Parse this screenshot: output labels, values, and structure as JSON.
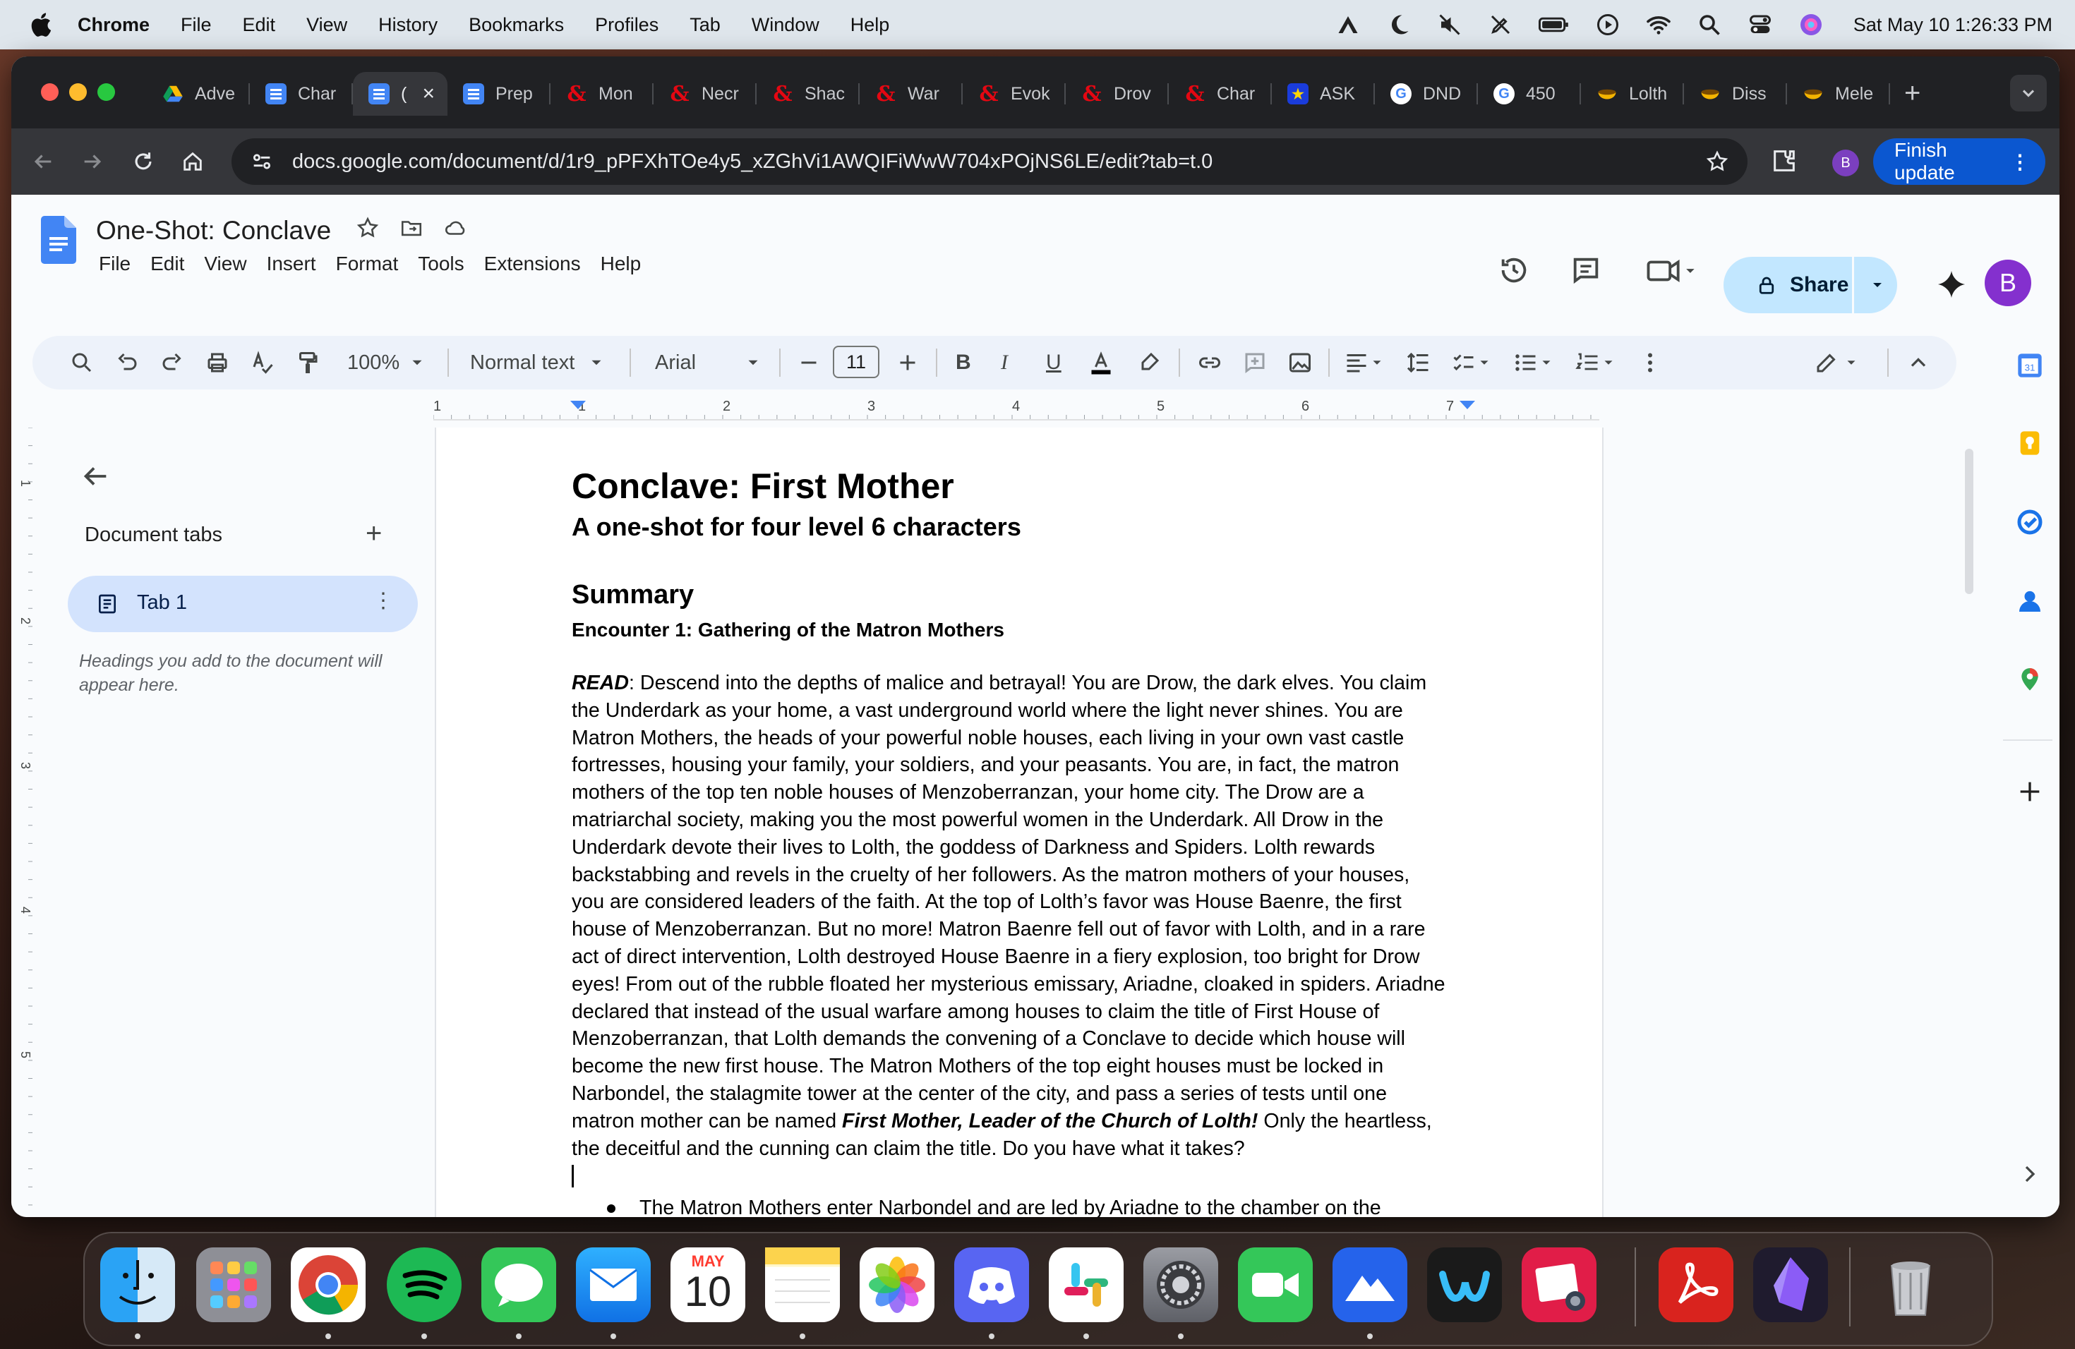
{
  "menubar": {
    "app": "Chrome",
    "items": [
      "File",
      "Edit",
      "View",
      "History",
      "Bookmarks",
      "Profiles",
      "Tab",
      "Window",
      "Help"
    ],
    "clock": "Sat May 10  1:26:33 PM"
  },
  "browser": {
    "tabs": [
      {
        "label": "Adve",
        "icon": "google-drive-icon",
        "color": "#fbbc04"
      },
      {
        "label": "Char",
        "icon": "google-docs-icon",
        "color": "#4285f4"
      },
      {
        "label": "(",
        "icon": "google-docs-icon",
        "color": "#4285f4",
        "active": true
      },
      {
        "label": "Prep",
        "icon": "google-docs-icon",
        "color": "#4285f4"
      },
      {
        "label": "Mon",
        "icon": "dnd-ampersand-icon",
        "color": "#e40712"
      },
      {
        "label": "Necr",
        "icon": "dnd-ampersand-icon",
        "color": "#e40712"
      },
      {
        "label": "Shac",
        "icon": "dnd-ampersand-icon",
        "color": "#e40712"
      },
      {
        "label": "War",
        "icon": "dnd-ampersand-icon",
        "color": "#e40712"
      },
      {
        "label": "Evok",
        "icon": "dnd-ampersand-icon",
        "color": "#e40712"
      },
      {
        "label": "Drov",
        "icon": "dnd-ampersand-icon",
        "color": "#e40712"
      },
      {
        "label": "Char",
        "icon": "dnd-ampersand-icon",
        "color": "#e40712"
      },
      {
        "label": "ASK",
        "icon": "star-badge-icon",
        "color": "#1a3cdb"
      },
      {
        "label": "DND",
        "icon": "google-g-icon",
        "color": "#ffffff"
      },
      {
        "label": "450",
        "icon": "google-g-icon",
        "color": "#ffffff"
      },
      {
        "label": "Lolth",
        "icon": "bowl-icon",
        "color": "#f4b400"
      },
      {
        "label": "Diss",
        "icon": "bowl-icon",
        "color": "#f4b400"
      },
      {
        "label": "Mele",
        "icon": "bowl-icon",
        "color": "#f4b400"
      }
    ],
    "url": "docs.google.com/document/d/1r9_pPFXhTOe4y5_xZGhVi1AWQIFiWwW704xPOjNS6LE/edit?tab=t.0",
    "profile_initial": "B",
    "finish_update": "Finish update"
  },
  "doc": {
    "title": "One-Shot: Conclave",
    "menus": [
      "File",
      "Edit",
      "View",
      "Insert",
      "Format",
      "Tools",
      "Extensions",
      "Help"
    ],
    "share": "Share",
    "avatar": "B",
    "toolbar": {
      "zoom": "100%",
      "style": "Normal text",
      "font": "Arial",
      "font_size": "11"
    },
    "ruler_labels": [
      "1",
      "1",
      "2",
      "3",
      "4",
      "5",
      "6",
      "7"
    ],
    "vruler_labels": [
      "1",
      "2",
      "3",
      "4",
      "5"
    ],
    "sidebar": {
      "title": "Document tabs",
      "tab": "Tab 1",
      "hint": "Headings you add to the document will appear here."
    },
    "content": {
      "title": "Conclave: First Mother",
      "subtitle": "A one-shot for four level 6 characters",
      "heading": "Summary",
      "subheading": "Encounter 1: Gathering of the Matron Mothers",
      "read_label": "READ",
      "para_part1": ": Descend into the depths of malice and betrayal! You are Drow, the dark elves. You claim the Underdark as your home, a vast underground world where the light never shines. You are Matron Mothers, the heads of your powerful noble houses, each living in your own vast castle fortresses, housing your family, your soldiers, and your peasants. You are, in fact, the matron mothers of the top ten noble houses of Menzoberranzan, your home city. The Drow are a matriarchal society, making you the most powerful women in the Underdark. All Drow in the Underdark devote their lives to Lolth, the goddess of Darkness and Spiders. Lolth rewards backstabbing and revels in the cruelty of her followers. As the matron mothers of your houses, you are considered leaders of the faith. At the top of Lolth’s favor was House Baenre, the first house of Menzoberranzan. But no more! Matron Baenre fell out of favor with Lolth, and in a rare act of direct intervention, Lolth destroyed House Baenre in a fiery explosion, too bright for Drow eyes! From out of the rubble floated her mysterious emissary, Ariadne, cloaked in spiders. Ariadne declared that instead of the usual warfare among houses to claim the title of First House of Menzoberranzan, that Lolth demands the convening of a Conclave to decide which house will become the new first house. The Matron Mothers of the top eight houses must be locked in Narbondel, the stalagmite tower at the center of the city, and pass a series of tests until one matron mother can be named ",
      "para_emph": "First Mother, Leader of the Church of Lolth!",
      "para_part2": " Only the heartless, the deceitful and the cunning can claim the title. Do you have what it takes?",
      "bullet": "The Matron Mothers enter Narbondel and are led by Ariadne to the chamber on the highest floor, a room carved into the stone, with eight stone thrones (carved from the room itself) in a circle."
    }
  },
  "dock": {
    "calendar_month": "MAY",
    "calendar_day": "10"
  }
}
